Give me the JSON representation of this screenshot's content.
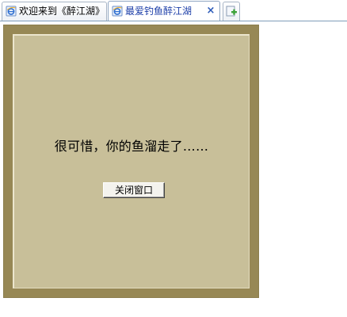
{
  "tabs": [
    {
      "label": "欢迎来到《醉江湖》",
      "icon": "ie-page-icon",
      "active": false
    },
    {
      "label": "最爱钓鱼醉江湖",
      "icon": "ie-page-icon",
      "active": true
    }
  ],
  "tab_close_symbol": "×",
  "new_tab_icon": "new-tab-plus-icon",
  "dialog": {
    "message": "很可惜，你的鱼溜走了……",
    "close_button_label": "关闭窗口"
  },
  "colors": {
    "frame": "#978855",
    "panel": "#c8bf99",
    "active_tab_text": "#1c3ea8"
  }
}
